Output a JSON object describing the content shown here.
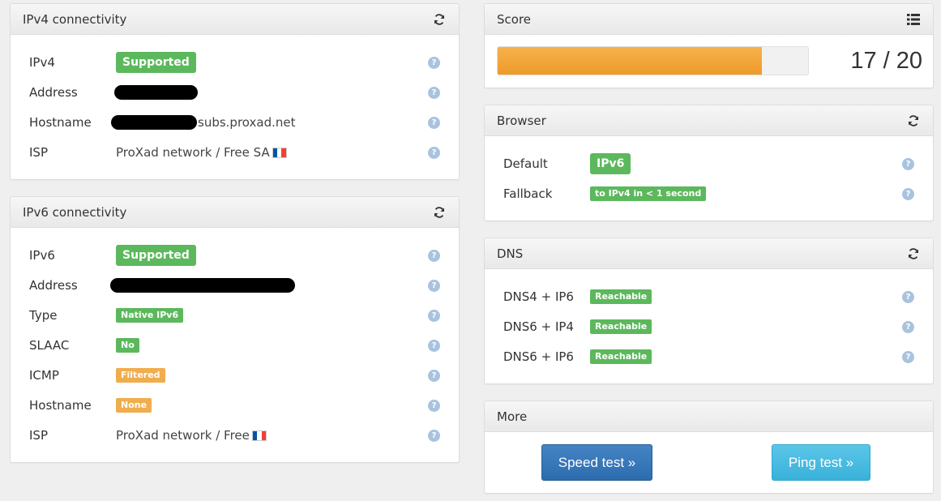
{
  "ipv4_panel": {
    "title": "IPv4 connectivity",
    "rows": [
      {
        "label": "IPv4",
        "badge": "Supported"
      },
      {
        "label": "Address"
      },
      {
        "label": "Hostname",
        "value": "subs.proxad.net"
      },
      {
        "label": "ISP",
        "value": "ProXad network / Free SA"
      }
    ],
    "help_glyph": "?"
  },
  "ipv6_panel": {
    "title": "IPv6 connectivity",
    "rows": [
      {
        "label": "IPv6",
        "badge": "Supported"
      },
      {
        "label": "Address"
      },
      {
        "label": "Type",
        "badge": "Native IPv6"
      },
      {
        "label": "SLAAC",
        "badge": "No"
      },
      {
        "label": "ICMP",
        "badge": "Filtered"
      },
      {
        "label": "Hostname",
        "badge": "None"
      },
      {
        "label": "ISP",
        "value": "ProXad network / Free"
      }
    ]
  },
  "score_panel": {
    "title": "Score",
    "score_text": "17 / 20",
    "progress_fraction": 0.85
  },
  "browser_panel": {
    "title": "Browser",
    "rows": [
      {
        "label": "Default",
        "badge": "IPv6"
      },
      {
        "label": "Fallback",
        "badge": "to IPv4 in < 1 second"
      }
    ]
  },
  "dns_panel": {
    "title": "DNS",
    "rows": [
      {
        "label": "DNS4 + IP6",
        "badge": "Reachable"
      },
      {
        "label": "DNS6 + IP4",
        "badge": "Reachable"
      },
      {
        "label": "DNS6 + IP6",
        "badge": "Reachable"
      }
    ]
  },
  "more_panel": {
    "title": "More",
    "speed_test": "Speed test »",
    "ping_test": "Ping test »"
  },
  "icons": {
    "refresh": "refresh-icon",
    "list": "list-icon",
    "help": "help-icon",
    "flag": "france-flag-icon"
  },
  "colors": {
    "success": "#5cb85c",
    "warning": "#f0ad4e",
    "progress": "#ee9a2a",
    "primary_button": "#2d6cae",
    "info_button": "#39b1da"
  }
}
